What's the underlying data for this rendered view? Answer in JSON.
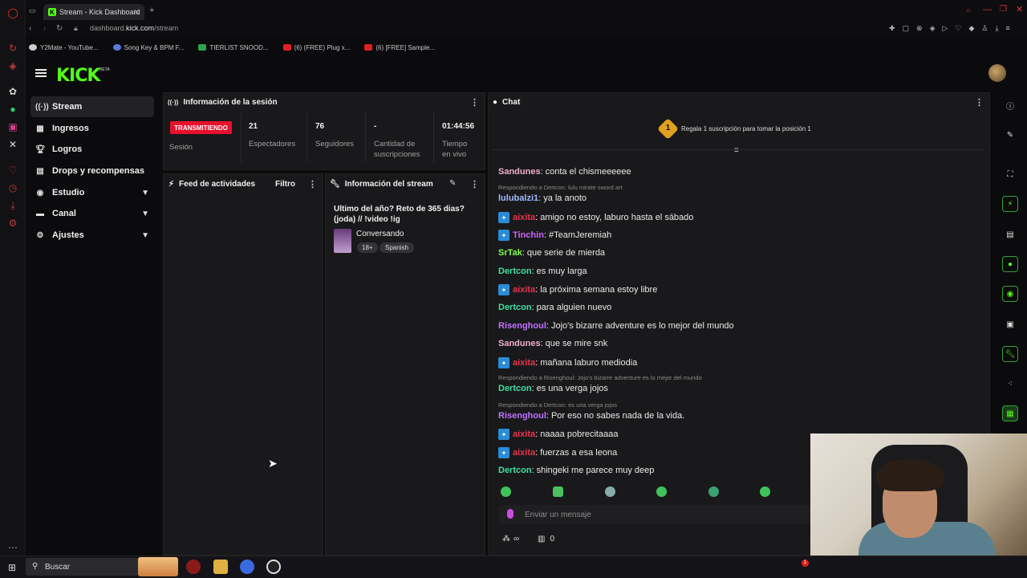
{
  "browser": {
    "tab_title": "Stream - Kick Dashboard",
    "url_host": "dashboard.",
    "url_domain": "kick.com",
    "url_path": "/stream",
    "bookmarks": [
      "Y2Mate - YouTube...",
      "Song Key & BPM F...",
      "TIERLIST SNOOD...",
      "(6) (FREE) Plug x...",
      "(6) [FREE] Sample..."
    ]
  },
  "header": {
    "logo": "KICK",
    "beta": "BETA"
  },
  "sidebar": {
    "items": [
      {
        "label": "Stream",
        "icon": "broadcast-icon"
      },
      {
        "label": "Ingresos",
        "icon": "chart-icon"
      },
      {
        "label": "Logros",
        "icon": "trophy-icon"
      },
      {
        "label": "Drops y recompensas",
        "icon": "gift-icon"
      },
      {
        "label": "Estudio",
        "icon": "palette-icon"
      },
      {
        "label": "Canal",
        "icon": "tv-icon"
      },
      {
        "label": "Ajustes",
        "icon": "gear-icon"
      }
    ]
  },
  "session": {
    "title": "Información de la sesión",
    "status": "TRANSMITIENDO",
    "status_label": "Sesión",
    "viewers": "21",
    "viewers_label": "Espectadores",
    "followers": "76",
    "followers_label": "Seguidores",
    "subs": "-",
    "subs_label_1": "Cantidad de",
    "subs_label_2": "suscripciones",
    "time": "01:44:56",
    "time_label_1": "Tiempo",
    "time_label_2": "en vivo"
  },
  "feed": {
    "title": "Feed de actividades",
    "filter": "Filtro"
  },
  "stream_info": {
    "title": "Información del stream",
    "stream_title_1": "Ultimo del año? Reto de 365 dias?",
    "stream_title_2": "(joda) // !video !ig",
    "category": "Conversando",
    "tags": [
      "18+",
      "Spanish"
    ]
  },
  "chat": {
    "title": "Chat",
    "gift_rank": "1",
    "gift_text": "Regala 1 suscripción para tomar la posición 1",
    "messages": [
      {
        "user": "Sandunes",
        "text": "conta el chismeeeeee",
        "color": "#f0b0c8",
        "badge": false
      },
      {
        "reply": "Respondiendo a Dertcon: lulu mirate sword art"
      },
      {
        "user": "lulubalzi1",
        "text": "ya la anoto",
        "color": "#a0b8ff",
        "badge": false
      },
      {
        "user": "aixita",
        "text": "amigo no estoy, laburo hasta el sábado",
        "color": "#e8334c",
        "badge": true
      },
      {
        "user": "Tinchin",
        "text": "#TeamJeremiah",
        "color": "#d060ff",
        "badge": true
      },
      {
        "user": "SrTak",
        "text": "que serie de mierda",
        "color": "#80ff40",
        "badge": false
      },
      {
        "user": "Dertcon",
        "text": "es muy larga",
        "color": "#40e0a0",
        "badge": false
      },
      {
        "user": "aixita",
        "text": "la próxima semana estoy libre",
        "color": "#e8334c",
        "badge": true
      },
      {
        "user": "Dertcon",
        "text": "para alguien nuevo",
        "color": "#40e0a0",
        "badge": false
      },
      {
        "user": "Risenghoul",
        "text": "Jojo's bizarre adventure es lo mejor del mundo",
        "color": "#c070ff",
        "badge": false
      },
      {
        "user": "Sandunes",
        "text": "que se mire snk",
        "color": "#f0b0c8",
        "badge": false
      },
      {
        "user": "aixita",
        "text": "mañana laburo mediodia",
        "color": "#e8334c",
        "badge": true
      },
      {
        "reply": "Respondiendo a Risenghoul: Jojo's bizarre adventure es lo mejor del mundo"
      },
      {
        "user": "Dertcon",
        "text": "es una verga jojos",
        "color": "#40e0a0",
        "badge": false
      },
      {
        "reply": "Respondiendo a Dertcon: es una verga jojos"
      },
      {
        "user": "Risenghoul",
        "text": "Por eso no sabes nada de la vida.",
        "color": "#c070ff",
        "badge": false
      },
      {
        "user": "aixita",
        "text": "naaaa pobrecitaaaa",
        "color": "#e8334c",
        "badge": true
      },
      {
        "user": "aixita",
        "text": "fuerzas a esa leona",
        "color": "#e8334c",
        "badge": true
      },
      {
        "user": "Dertcon",
        "text": "shingeki me parece muy deep",
        "color": "#40e0a0",
        "badge": false
      }
    ],
    "input_placeholder": "Enviar un mensaje",
    "points": "∞",
    "shop_count": "0"
  },
  "taskbar": {
    "search": "Buscar",
    "notification": "1"
  },
  "colors": {
    "accent": "#53fc18",
    "live": "#e8112d"
  }
}
